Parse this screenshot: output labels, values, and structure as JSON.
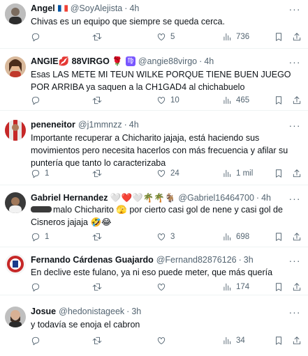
{
  "tweets": [
    {
      "name": "Angel",
      "handle": "@SoyAlejista",
      "time": "4h",
      "text": "Chivas es un equipo que siempre se queda cerca.",
      "reply": "",
      "retweets": "",
      "likes": "5",
      "views": "736"
    },
    {
      "name": "ANGIE💋 88VIRGO 🌹",
      "handle": "@angie88virgo",
      "time": "4h",
      "text": "Esas LAS METE MI TEUN WILKE PORQUE TIENE BUEN JUEGO POR ARRIBA ya saquen a la CH1GAD4 al chichabuelo",
      "reply": "",
      "retweets": "",
      "likes": "10",
      "views": "465"
    },
    {
      "name": "peneneitor",
      "handle": "@j1mmnzz",
      "time": "4h",
      "text": "Importante recuperar a Chicharito jajaja, está haciendo sus movimientos pero necesita hacerlos con más frecuencia y afilar su puntería que tanto lo caracterizaba",
      "reply": "1",
      "retweets": "",
      "likes": "24",
      "views": "1 mil"
    },
    {
      "name": "Gabriel Hernandez 🤍❤️🤍🌴🌴🐐",
      "handle": "@Gabriel16464700",
      "time": "4h",
      "text": "malo Chicharito 🫣 por cierto casi gol de nene y casi gol de Cisneros jajaja 🤣😂",
      "reply": "1",
      "retweets": "",
      "likes": "3",
      "views": "698"
    },
    {
      "name": "Fernando Cárdenas Guajardo",
      "handle": "@Fernand82876126",
      "time": "3h",
      "text": "En declive este fulano, ya ni eso puede meter, que más quería",
      "reply": "",
      "retweets": "",
      "likes": "",
      "views": "174"
    },
    {
      "name": "Josue",
      "handle": "@hedonistageek",
      "time": "3h",
      "text": "y todavía se enoja el cabron",
      "reply": "",
      "retweets": "",
      "likes": "",
      "views": "34"
    }
  ],
  "icons": {
    "reply": "reply-icon",
    "retweet": "retweet-icon",
    "like": "like-icon",
    "views": "views-icon",
    "bookmark": "bookmark-icon",
    "share": "share-icon",
    "more": "more-icon"
  },
  "colors": {
    "text": "#0f1419",
    "secondary": "#536471",
    "divider": "#eff3f4",
    "verified_badge": "#7856ff"
  }
}
